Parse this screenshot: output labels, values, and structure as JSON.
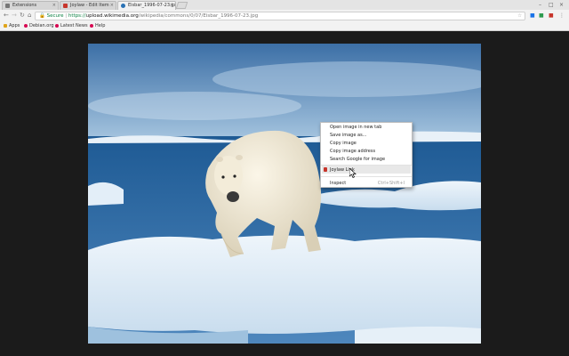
{
  "tabs": [
    {
      "title": "Extensions"
    },
    {
      "title": "Joylaw - Edit Item"
    },
    {
      "title": "Eisbar_1996-07-23.jp",
      "active": true
    }
  ],
  "tab_close_glyph": "×",
  "window_controls": [
    "–",
    "□",
    "×"
  ],
  "omnibox": {
    "secure_label": "Secure",
    "separator": "|",
    "scheme": "https://",
    "host": "upload.wikimedia.org",
    "path": "/wikipedia/commons/0/07/Eisbar_1996-07-23.jpg"
  },
  "nav_icons": [
    "back-icon",
    "forward-icon",
    "reload-icon",
    "home-icon"
  ],
  "bookmarks": [
    {
      "label": "Apps",
      "icon": "apps-grid-icon",
      "color": "#e0a41a"
    },
    {
      "label": "Debian.org",
      "icon": "debian-icon",
      "color": "#d70751"
    },
    {
      "label": "Latest News",
      "icon": "news-icon",
      "color": "#d70751"
    },
    {
      "label": "Help",
      "icon": "help-icon",
      "color": "#d70751"
    }
  ],
  "context_menu": {
    "items": [
      "Open image in new tab",
      "Save image as...",
      "Copy image",
      "Copy image address",
      "Search Google for image"
    ],
    "extension_item": "Joylaw Link",
    "inspect_label": "Inspect",
    "inspect_shortcut": "Ctrl+Shift+I"
  },
  "colors": {
    "secure_green": "#0b8043",
    "page_background": "#1b1b1b",
    "sky": "#3c6fa6",
    "water": "#1e5a94",
    "ice": "#eef5fb"
  }
}
